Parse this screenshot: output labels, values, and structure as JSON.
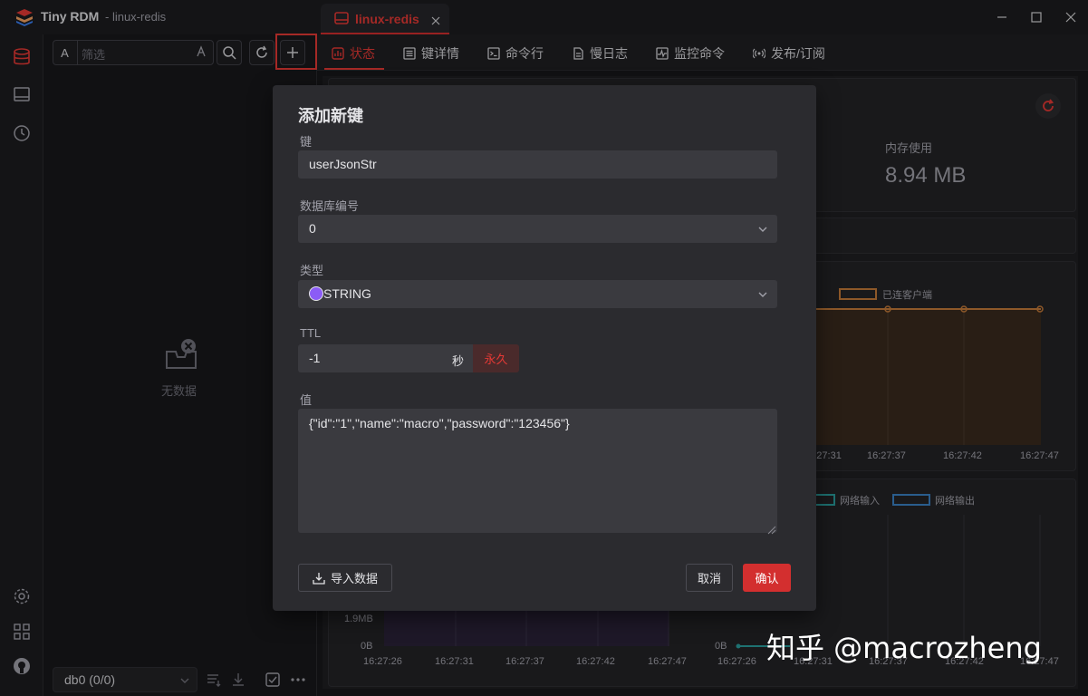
{
  "window": {
    "app_name": "Tiny RDM",
    "connection_suffix": "- linux-redis"
  },
  "connection_tab": {
    "label": "linux-redis"
  },
  "sub_tabs": [
    {
      "label": "状态",
      "icon": "chart-icon",
      "active": true
    },
    {
      "label": "键详情",
      "icon": "list-icon"
    },
    {
      "label": "命令行",
      "icon": "terminal-icon"
    },
    {
      "label": "慢日志",
      "icon": "doc-icon"
    },
    {
      "label": "监控命令",
      "icon": "pulse-icon"
    },
    {
      "label": "发布/订阅",
      "icon": "broadcast-icon"
    }
  ],
  "key_panel": {
    "filter_toggle": "A",
    "filter_placeholder": "筛选",
    "empty_text": "无数据",
    "db_select": "db0 (0/0)"
  },
  "status": {
    "memory_label": "内存使用",
    "memory_value": "8.94 MB",
    "clients_legend": "已连客户端",
    "net_in_legend": "网络输入",
    "net_out_legend": "网络输出",
    "chart1_x": [
      "16:27:31",
      "16:27:37",
      "16:27:42",
      "16:27:47"
    ],
    "chart2_y": [
      "1.9MB",
      "0B"
    ],
    "chart2_x": [
      "16:27:26",
      "16:27:31",
      "16:27:37",
      "16:27:42",
      "16:27:47"
    ],
    "chart3_y": [
      "0B"
    ],
    "chart3_x": [
      "16:27:26",
      "16:27:31",
      "16:27:37",
      "16:27:42",
      "16:27:47"
    ]
  },
  "dialog": {
    "title": "添加新键",
    "key_label": "键",
    "key_value": "userJsonStr",
    "db_label": "数据库编号",
    "db_value": "0",
    "type_label": "类型",
    "type_value": "STRING",
    "type_color": "#8b5cf6",
    "ttl_label": "TTL",
    "ttl_value": "-1",
    "ttl_unit": "秒",
    "ttl_forever": "永久",
    "value_label": "值",
    "value_text": "{\"id\":\"1\",\"name\":\"macro\",\"password\":\"123456\"}",
    "import_label": "导入数据",
    "cancel_label": "取消",
    "confirm_label": "确认"
  },
  "watermark": "知乎 @macrozheng",
  "colors": {
    "accent": "#e53935",
    "chart_orange": "#c47a3a",
    "chart_teal": "#2a9d9d",
    "chart_purple": "#3b2a55"
  }
}
